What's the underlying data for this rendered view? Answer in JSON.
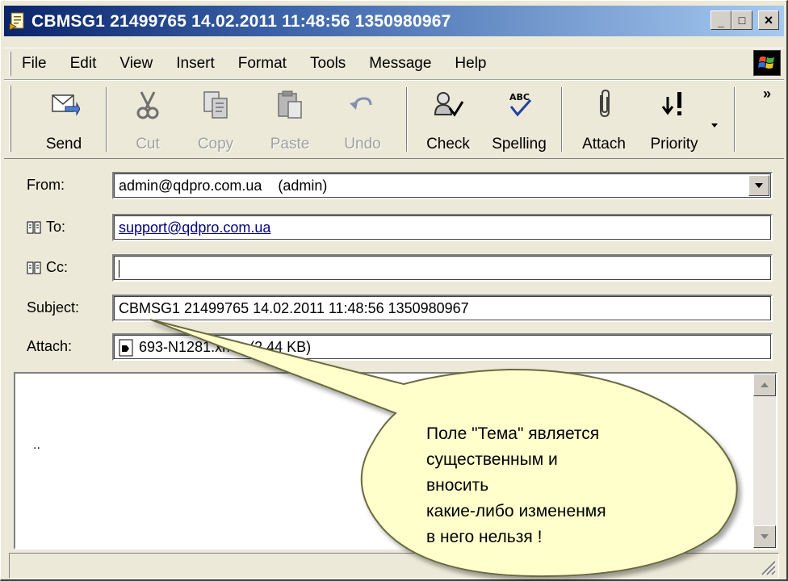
{
  "window": {
    "title": "CBMSG1 21499765 14.02.2011 11:48:56 1350980967",
    "minimize_label": "_",
    "maximize_label": "□",
    "close_label": "×"
  },
  "menu": [
    "File",
    "Edit",
    "View",
    "Insert",
    "Format",
    "Tools",
    "Message",
    "Help"
  ],
  "toolbar": {
    "send": "Send",
    "cut": "Cut",
    "copy": "Copy",
    "paste": "Paste",
    "undo": "Undo",
    "check": "Check",
    "spelling": "Spelling",
    "attach": "Attach",
    "priority": "Priority",
    "more": "»"
  },
  "fields": {
    "from_label": "From:",
    "from_value": "admin@qdpro.com.ua    (admin)",
    "to_label": "To:",
    "to_value": "support@qdpro.com.ua",
    "cc_label": "Cc:",
    "cc_value": "",
    "subject_label": "Subject:",
    "subject_value": "CBMSG1 21499765 14.02.2011 11:48:56 1350980967",
    "attach_label": "Attach:",
    "attach_value": "693-N1281.xmfx (2,44 KB)"
  },
  "body": {
    "text": ".."
  },
  "callout": {
    "lines": [
      "Поле \"Тема\" является",
      "существенным и",
      "вносить",
      "какие-либо измененмя",
      "в него нельзя !"
    ]
  },
  "colors": {
    "titlebar_start": "#0a246a",
    "titlebar_end": "#a6caf0",
    "callout_fill": "#ffffcc",
    "link": "#000080"
  }
}
